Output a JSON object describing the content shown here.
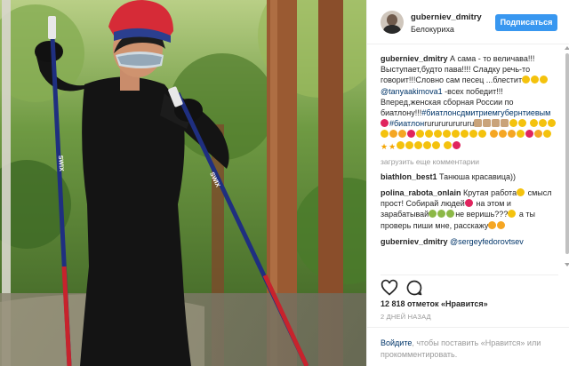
{
  "post": {
    "username": "guberniev_dmitry",
    "location": "Белокуриха",
    "follow_label": "Подписаться",
    "photo": {
      "pole_left_text": "SWIX",
      "pole_right_text": "SWIX"
    },
    "caption": {
      "username": "guberniev_dmitry",
      "text_1": "А сама - то величава!!!Выступает,будто пава!!!! Сладку речь-то говорит!!!Словно сам песец ...блестит",
      "mention": "@tanyaakimova1",
      "text_2": " -всех победит!!!Вперед,женская сборная России по биатлону!!!",
      "hashtag_1": "#биатлонсдмитриемгубернтиевым",
      "hashtag_2": "#биатлон",
      "text_3": "rururururururu"
    },
    "load_more": "загрузить еще комментарии",
    "comments": [
      {
        "username": "biathlon_best1",
        "text": "Танюша красавица))"
      },
      {
        "username": "polina_rabota_onlain",
        "text_a": "Крутая работа",
        "text_b": "смысл прост! Собирай людей",
        "text_c": "на этом и зарабатывай",
        "text_d": "не веришь???",
        "text_e": "а ты проверь",
        "text_f": "пиши мне, расскажу"
      },
      {
        "username": "guberniev_dmitry",
        "mention": "@sergeyfedorovtsev"
      }
    ],
    "likes": "12 818 отметок «Нравится»",
    "time_ago": "2 ДНЕЙ НАЗАД",
    "login": {
      "link": "Войдите",
      "text": ", чтобы поставить «Нравится» или прокомментировать."
    }
  },
  "icons": [
    "heart-icon",
    "comment-icon"
  ],
  "colors": {
    "follow_button": "#3897f0",
    "link": "#003569",
    "muted": "#999999"
  }
}
